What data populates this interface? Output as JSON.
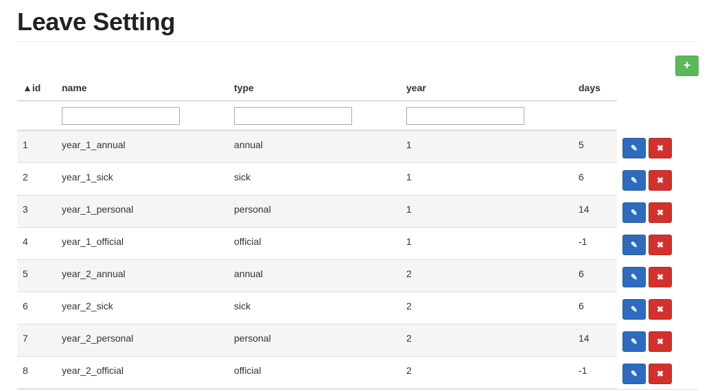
{
  "page": {
    "title": "Leave Setting"
  },
  "toolbar": {
    "add_icon": "plus-icon",
    "add_label": "+"
  },
  "table": {
    "columns": [
      "▲id",
      "name",
      "type",
      "year",
      "days"
    ],
    "filters": {
      "name": "",
      "type": "",
      "year": ""
    },
    "rows": [
      [
        "1",
        "year_1_annual",
        "annual",
        "1",
        "5"
      ],
      [
        "2",
        "year_1_sick",
        "sick",
        "1",
        "6"
      ],
      [
        "3",
        "year_1_personal",
        "personal",
        "1",
        "14"
      ],
      [
        "4",
        "year_1_official",
        "official",
        "1",
        "-1"
      ],
      [
        "5",
        "year_2_annual",
        "annual",
        "2",
        "6"
      ],
      [
        "6",
        "year_2_sick",
        "sick",
        "2",
        "6"
      ],
      [
        "7",
        "year_2_personal",
        "personal",
        "2",
        "14"
      ],
      [
        "8",
        "year_2_official",
        "official",
        "2",
        "-1"
      ]
    ],
    "row_actions": {
      "edit_icon": "pencil-icon",
      "delete_icon": "times-icon"
    }
  },
  "colors": {
    "add": "#5cb85c",
    "edit": "#2e6bbf",
    "delete": "#d2322d"
  }
}
